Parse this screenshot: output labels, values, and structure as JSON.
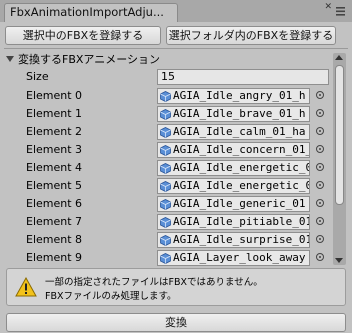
{
  "window": {
    "tab_title": "FbxAnimationImportAdju..."
  },
  "toolbar": {
    "register_selected_label": "選択中のFBXを登録する",
    "register_folder_label": "選択フォルダ内のFBXを登録する"
  },
  "animations": {
    "foldout_label": "変換するFBXアニメーション",
    "size_label": "Size",
    "size_value": "15",
    "elements": [
      {
        "label": "Element 0",
        "value": "AGIA_Idle_angry_01_h"
      },
      {
        "label": "Element 1",
        "value": "AGIA_Idle_brave_01_h"
      },
      {
        "label": "Element 2",
        "value": "AGIA_Idle_calm_01_ha"
      },
      {
        "label": "Element 3",
        "value": "AGIA_Idle_concern_01_"
      },
      {
        "label": "Element 4",
        "value": "AGIA_Idle_energetic_0"
      },
      {
        "label": "Element 5",
        "value": "AGIA_Idle_energetic_0"
      },
      {
        "label": "Element 6",
        "value": "AGIA_Idle_generic_01"
      },
      {
        "label": "Element 7",
        "value": "AGIA_Idle_pitiable_01_"
      },
      {
        "label": "Element 8",
        "value": "AGIA_Idle_surprise_01"
      },
      {
        "label": "Element 9",
        "value": "AGIA_Layer_look_away"
      }
    ]
  },
  "help": {
    "icon": "warning-icon",
    "line1": "一部の指定されたファイルはFBXではありません。",
    "line2": "FBXファイルのみ処理します。"
  },
  "footer": {
    "convert_label": "変換"
  },
  "colors": {
    "background": "#c2c2c2",
    "warning_yellow": "#f2c21b"
  }
}
